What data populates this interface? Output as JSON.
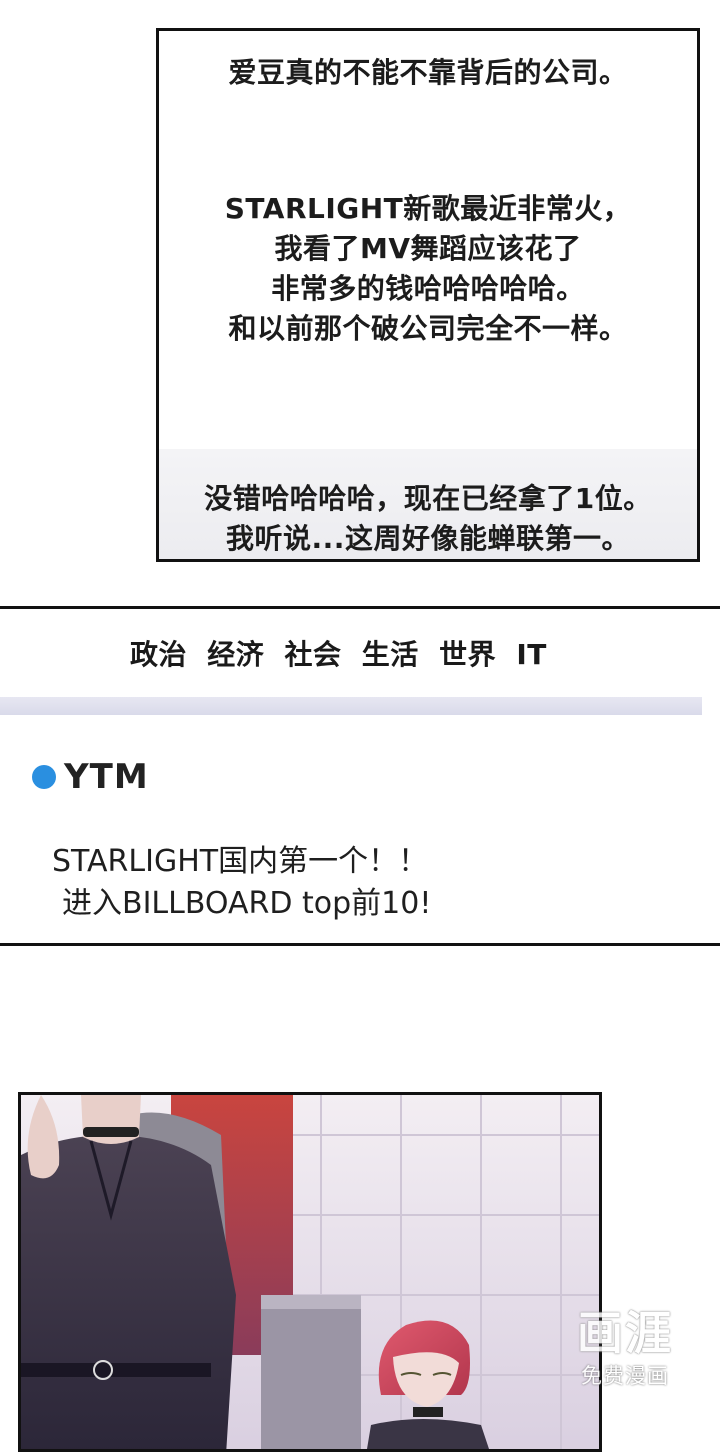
{
  "comment_box": {
    "line1": "爱豆真的不能不靠背后的公司。",
    "para2": [
      "STARLIGHT新歌最近非常火，",
      "我看了MV舞蹈应该花了",
      "非常多的钱哈哈哈哈哈。",
      "和以前那个破公司完全不一样。"
    ],
    "reply": [
      "没错哈哈哈哈，现在已经拿了1位。",
      "我听说...这周好像能蝉联第一。"
    ]
  },
  "news": {
    "nav": [
      "政治",
      "经济",
      "社会",
      "生活",
      "世界",
      "IT"
    ],
    "source": "YTM",
    "source_color": "#2a8fe0",
    "headline": [
      "STARLIGHT国内第一个！！",
      "进入BILLBOARD top前10!"
    ]
  },
  "watermark": {
    "logo": "画涯",
    "subtitle": "免费漫画"
  }
}
